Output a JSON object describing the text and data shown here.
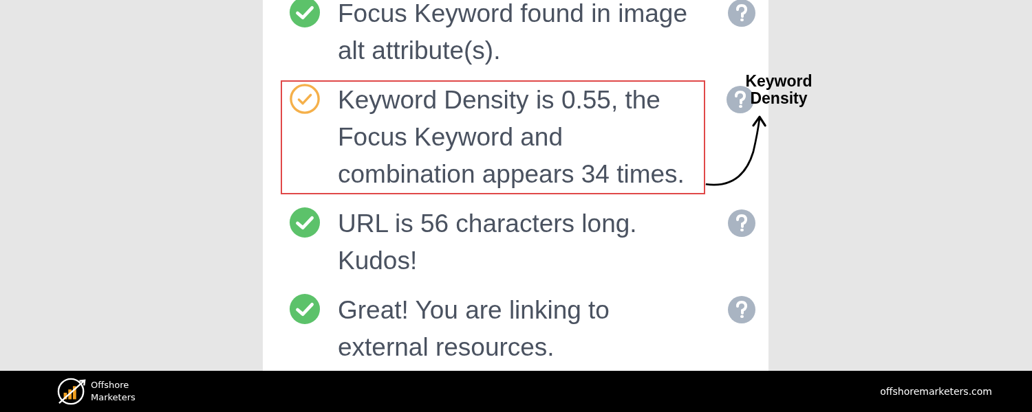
{
  "checks": [
    {
      "kind": "good",
      "text": "Focus Keyword found in image alt attribute(s).",
      "highlighted": false
    },
    {
      "kind": "warning",
      "text": "Keyword Density is 0.55, the Focus Keyword and combination appears 34 times.",
      "highlighted": true
    },
    {
      "kind": "good",
      "text": "URL is 56 characters long. Kudos!",
      "highlighted": false
    },
    {
      "kind": "good",
      "text": "Great! You are linking to external resources.",
      "highlighted": false
    }
  ],
  "annotation": {
    "label": "Keyword Density"
  },
  "footer": {
    "brand": "Offshore Marketers",
    "url": "offshoremarketers.com"
  }
}
